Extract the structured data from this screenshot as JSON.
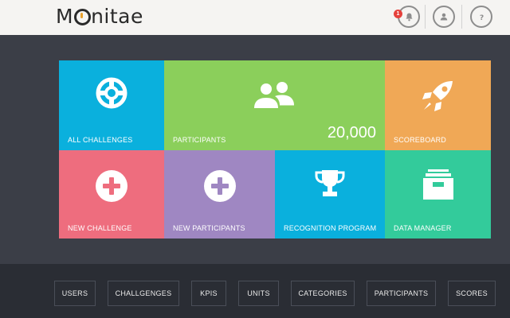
{
  "header": {
    "logo_text_before": "M",
    "logo_text_after": "nitae",
    "notifications_count": "1",
    "icons": [
      "bell-icon",
      "user-icon",
      "help-icon"
    ]
  },
  "tiles": [
    {
      "label": "ALL CHALLENGES",
      "color": "#0ab0dd",
      "icon": "lifebuoy-icon"
    },
    {
      "label": "PARTICIPANTS",
      "color": "#8bcf5b",
      "icon": "users-icon",
      "count": "20,000"
    },
    {
      "label": "SCOREBOARD",
      "color": "#f0a856",
      "icon": "rocket-icon"
    },
    {
      "label": "NEW CHALLENGE",
      "color": "#ee6d7e",
      "icon": "plus-circle-icon"
    },
    {
      "label": "NEW PARTICIPANTS",
      "color": "#9f87c2",
      "icon": "plus-circle-icon"
    },
    {
      "label": "RECOGNITION PROGRAM",
      "color": "#0ab0dd",
      "icon": "trophy-icon"
    },
    {
      "label": "DATA MANAGER",
      "color": "#33cb9b",
      "icon": "archive-icon"
    }
  ],
  "nav": [
    "USERS",
    "CHALLGENGES",
    "KPIS",
    "UNITS",
    "CATEGORIES",
    "PARTICIPANTS",
    "SCORES"
  ]
}
